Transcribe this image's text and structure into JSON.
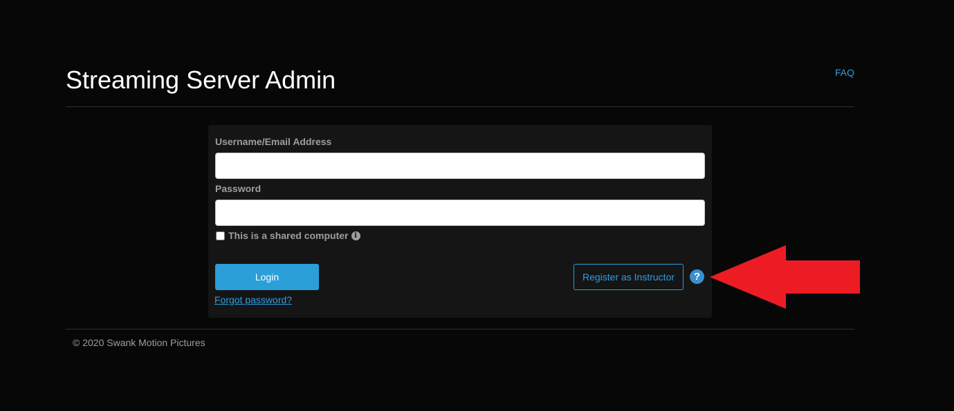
{
  "header": {
    "title": "Streaming Server Admin",
    "faq_label": "FAQ"
  },
  "login_form": {
    "username_label": "Username/Email Address",
    "username_value": "",
    "password_label": "Password",
    "password_value": "",
    "shared_computer_label": "This is a shared computer",
    "shared_computer_checked": false,
    "shared_info_icon": "info-circle-icon",
    "login_label": "Login",
    "forgot_password_label": "Forgot password?",
    "register_label": "Register as Instructor",
    "help_icon": "question-circle-icon",
    "help_glyph": "?"
  },
  "annotation": {
    "arrow_color": "#ed1c24",
    "arrow_direction": "left"
  },
  "footer": {
    "copyright": "© 2020 Swank Motion Pictures"
  },
  "colors": {
    "background": "#070707",
    "panel": "#151515",
    "accent": "#2b9fd8",
    "link": "#2e9fe0",
    "muted_text": "#9e9e9e"
  }
}
